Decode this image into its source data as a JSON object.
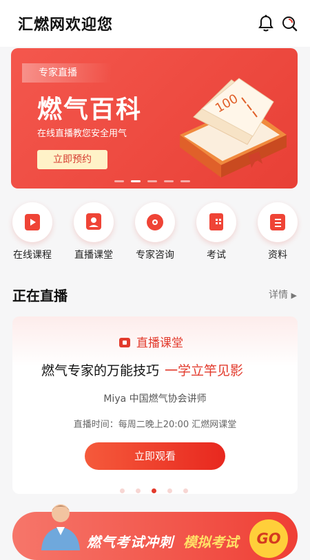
{
  "header": {
    "title": "汇燃网欢迎您"
  },
  "banner": {
    "tag": "专家直播",
    "title": "燃气百科",
    "subtitle": "在线直播教您安全用气",
    "button": "立即预约",
    "book_text": "100"
  },
  "categories": [
    {
      "label": "在线课程",
      "icon": "play-card-icon"
    },
    {
      "label": "直播课堂",
      "icon": "live-portrait-icon"
    },
    {
      "label": "专家咨询",
      "icon": "consult-icon"
    },
    {
      "label": "考试",
      "icon": "exam-icon"
    },
    {
      "label": "资料",
      "icon": "document-icon"
    }
  ],
  "live_section": {
    "title": "正在直播",
    "more": "详情"
  },
  "live_card": {
    "tag": "直播课堂",
    "title": "燃气专家的万能技巧",
    "title_highlight": "一学立竿见影",
    "speaker": "Miya 中国燃气协会讲师",
    "time": "直播时间：每周二晚上20:00 汇燃网课堂",
    "button": "立即观看"
  },
  "promo": {
    "text": "燃气考试冲刺",
    "highlight": "模拟考试",
    "go": "GO"
  },
  "colors": {
    "accent": "#e23a2c",
    "banner": "#f0493f",
    "gold": "#ffcf3a"
  }
}
